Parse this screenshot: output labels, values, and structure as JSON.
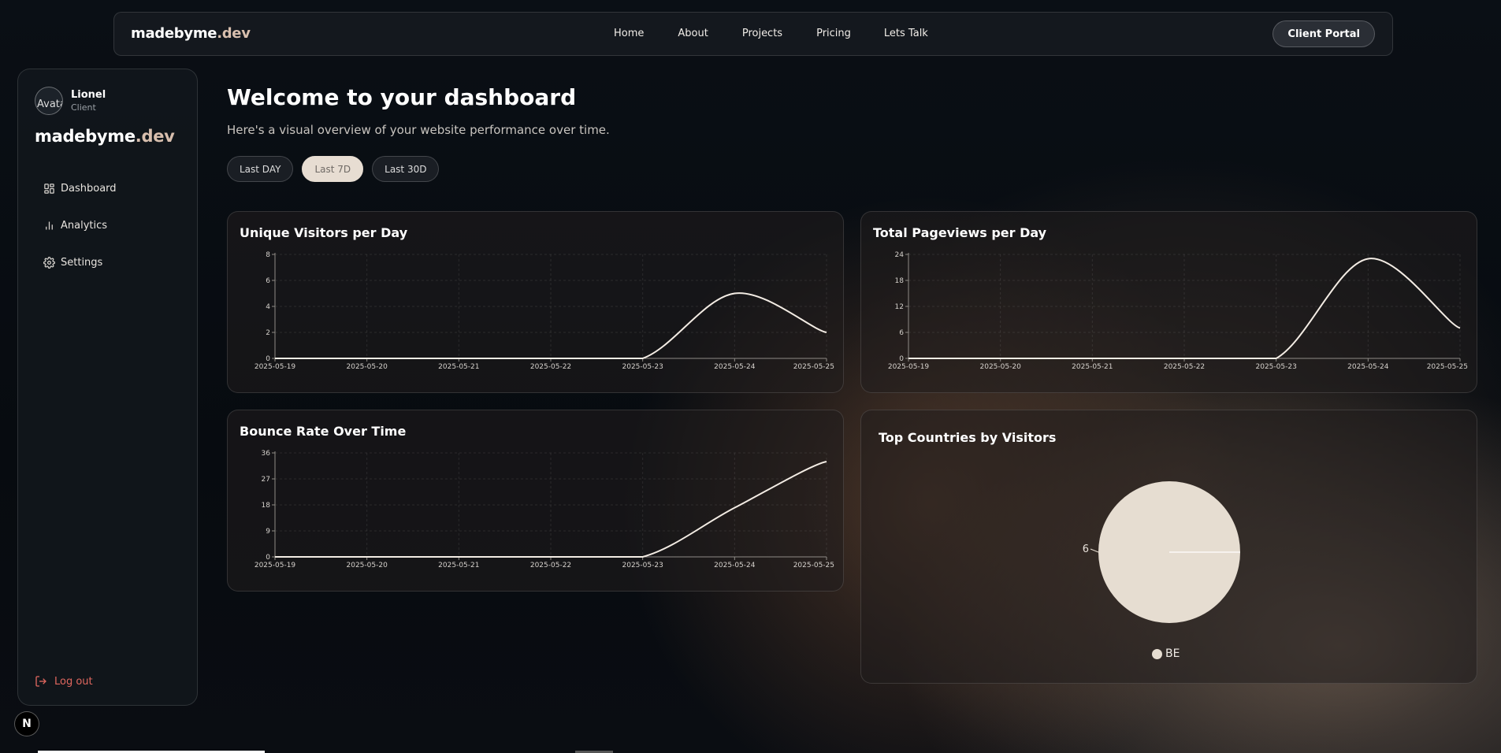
{
  "nav": {
    "logo_main": "madebyme",
    "logo_accent": ".dev",
    "links": [
      "Home",
      "About",
      "Projects",
      "Pricing",
      "Lets Talk"
    ],
    "portal_button": "Client Portal"
  },
  "sidebar": {
    "user": {
      "name": "Lionel",
      "role": "Client",
      "avatar_alt": "Avatar"
    },
    "logo_main": "madebyme",
    "logo_accent": ".dev",
    "items": [
      {
        "label": "Dashboard",
        "icon": "dashboard-grid-icon"
      },
      {
        "label": "Analytics",
        "icon": "bar-chart-icon"
      },
      {
        "label": "Settings",
        "icon": "gear-icon"
      }
    ],
    "logout": "Log out"
  },
  "badge": "N",
  "main": {
    "title": "Welcome to your dashboard",
    "subtitle": "Here's a visual overview of your website performance over time.",
    "ranges": [
      "Last DAY",
      "Last 7D",
      "Last 30D"
    ],
    "active_range": "Last 7D"
  },
  "colors": {
    "line": "#f3ece4",
    "pie": "#e6ddd1",
    "active_button": "#e7ddd2",
    "logout": "#e0675f"
  },
  "chart_data": [
    {
      "type": "line",
      "title": "Unique Visitors per Day",
      "x": [
        "2025-05-19",
        "2025-05-20",
        "2025-05-21",
        "2025-05-22",
        "2025-05-23",
        "2025-05-24",
        "2025-05-25"
      ],
      "series": [
        {
          "values": [
            0,
            0,
            0,
            0,
            0,
            5,
            2
          ]
        }
      ],
      "yticks": [
        0,
        2,
        4,
        6,
        8
      ],
      "ylim": [
        0,
        8
      ],
      "grid": true
    },
    {
      "type": "line",
      "title": "Total Pageviews per Day",
      "x": [
        "2025-05-19",
        "2025-05-20",
        "2025-05-21",
        "2025-05-22",
        "2025-05-23",
        "2025-05-24",
        "2025-05-25"
      ],
      "series": [
        {
          "values": [
            0,
            0,
            0,
            0,
            0,
            23,
            7
          ]
        }
      ],
      "yticks": [
        0,
        6,
        12,
        18,
        24
      ],
      "ylim": [
        0,
        24
      ],
      "grid": true
    },
    {
      "type": "line",
      "title": "Bounce Rate Over Time",
      "x": [
        "2025-05-19",
        "2025-05-20",
        "2025-05-21",
        "2025-05-22",
        "2025-05-23",
        "2025-05-24",
        "2025-05-25"
      ],
      "series": [
        {
          "values": [
            0,
            0,
            0,
            0,
            0,
            17,
            33
          ]
        }
      ],
      "yticks": [
        0,
        9,
        18,
        27,
        36
      ],
      "ylim": [
        0,
        36
      ],
      "grid": true
    },
    {
      "type": "pie",
      "title": "Top Countries by Visitors",
      "categories": [
        "BE"
      ],
      "values": [
        6
      ],
      "legend": "bottom"
    }
  ]
}
